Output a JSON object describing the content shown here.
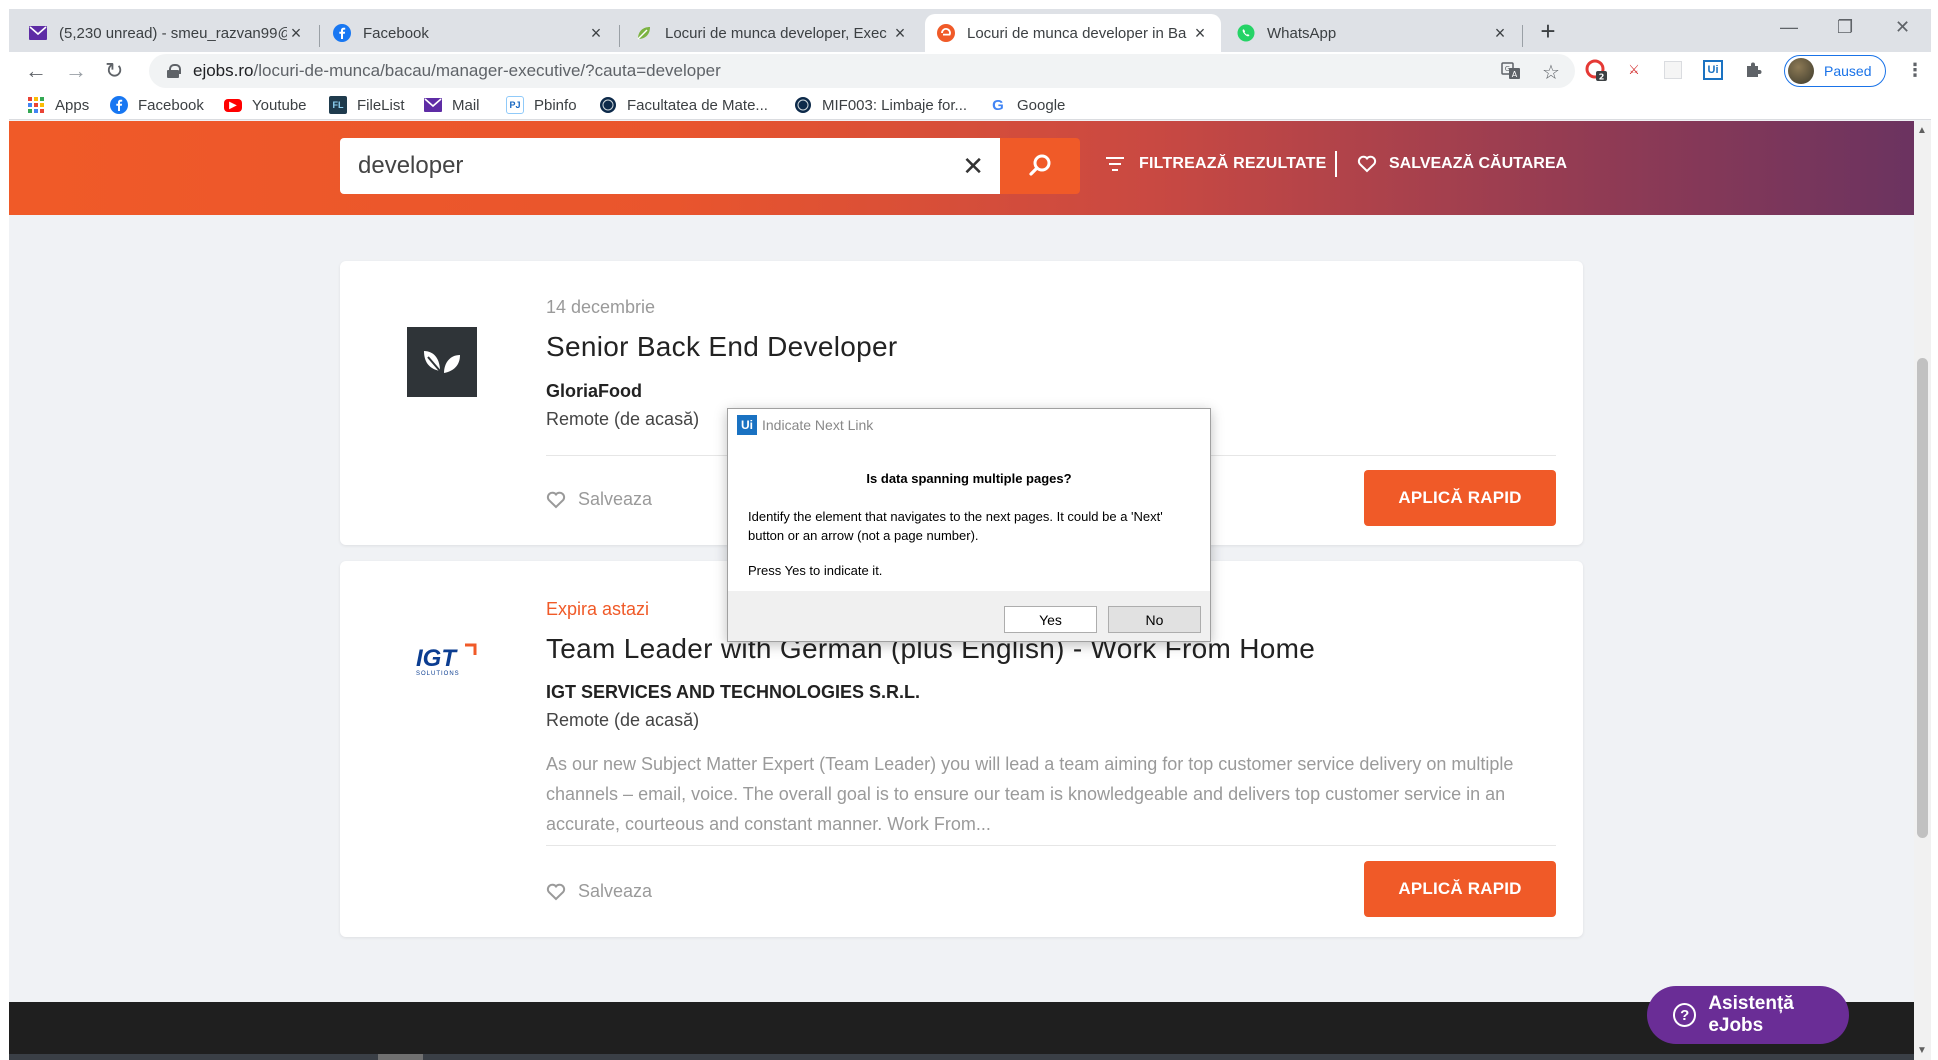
{
  "browser": {
    "tabs": [
      {
        "title": "(5,230 unread) - smeu_razvan99@",
        "icon": "mail-icon",
        "color": "#5e2ca5"
      },
      {
        "title": "Facebook",
        "icon": "facebook-icon",
        "color": "#1877f2"
      },
      {
        "title": "Locuri de munca developer, Exec",
        "icon": "ejobs-leaf-icon",
        "color": "#7cb342"
      },
      {
        "title": "Locuri de munca developer in Ba",
        "icon": "ejobs-icon",
        "color": "#f05a28"
      },
      {
        "title": "WhatsApp",
        "icon": "whatsapp-icon",
        "color": "#25d366"
      }
    ],
    "active_tab_index": 3,
    "url_host": "ejobs.ro",
    "url_path": "/locuri-de-munca/bacau/manager-executive/?cauta=developer",
    "profile_label": "Paused",
    "extension_badge": "2",
    "bookmarks": [
      {
        "label": "Apps",
        "icon": "apps-grid-icon"
      },
      {
        "label": "Facebook",
        "icon": "facebook-icon"
      },
      {
        "label": "Youtube",
        "icon": "youtube-icon"
      },
      {
        "label": "FileList",
        "icon": "filelist-icon",
        "badge": "FL"
      },
      {
        "label": "Mail",
        "icon": "mail-icon"
      },
      {
        "label": "Pbinfo",
        "icon": "pbinfo-icon",
        "badge": "PJ"
      },
      {
        "label": "Facultatea de Mate...",
        "icon": "university-icon"
      },
      {
        "label": "MIF003: Limbaje for...",
        "icon": "university-icon"
      },
      {
        "label": "Google",
        "icon": "google-icon",
        "badge": "G"
      }
    ]
  },
  "header": {
    "search_value": "developer",
    "filter_label": "FILTREAZĂ REZULTATE",
    "save_search_label": "SALVEAZĂ CĂUTAREA"
  },
  "jobs": [
    {
      "date": "14 decembrie",
      "title": "Senior Back End Developer",
      "company": "GloriaFood",
      "location": "Remote (de acasă)",
      "save_label": "Salveaza",
      "apply_label": "APLICĂ RAPID"
    },
    {
      "status": "Expira astazi",
      "title": "Team Leader with German (plus English) - Work From Home",
      "company": "IGT SERVICES AND TECHNOLOGIES S.R.L.",
      "location": "Remote (de acasă)",
      "description": "As our new Subject Matter Expert (Team Leader) you will lead a team aiming for top customer service delivery on multiple channels – email, voice. The overall goal is to ensure our team is knowledgeable and delivers top customer service in an accurate, courteous and constant manner. Work From...",
      "save_label": "Salveaza",
      "apply_label": "APLICĂ RAPID",
      "logo_text": "IGT",
      "logo_subtext": "SOLUTIONS"
    }
  ],
  "assist_label": "Asistență eJobs",
  "dialog": {
    "logo": "Ui",
    "title": "Indicate Next Link",
    "question": "Is data spanning multiple pages?",
    "message": "Identify the element that navigates to the next pages. It could be a 'Next' button or an arrow (not a page number).",
    "hint": "Press Yes to indicate it.",
    "yes_label": "Yes",
    "no_label": "No"
  },
  "colors": {
    "brand_orange": "#f05a28",
    "brand_purple": "#6a2d96",
    "uipath_blue": "#1a72c2"
  }
}
